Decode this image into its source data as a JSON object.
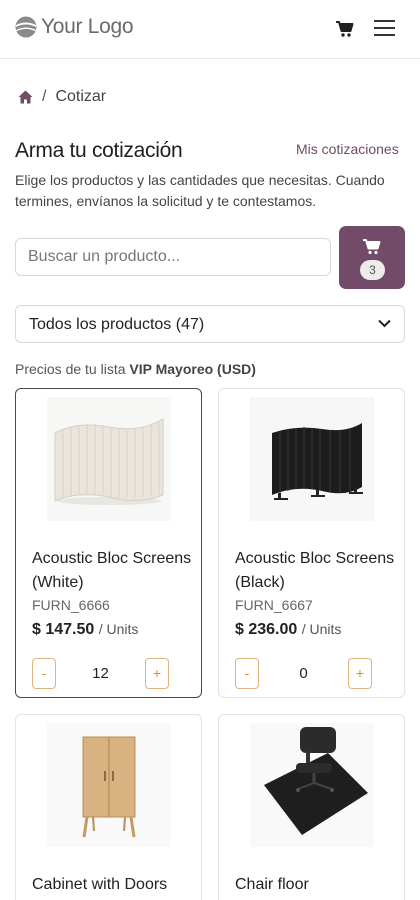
{
  "header": {
    "logo_text": "Your Logo",
    "icons": {
      "cart": "cart-icon",
      "menu": "hamburger-menu-icon"
    }
  },
  "breadcrumb": {
    "home_icon": "home-icon",
    "separator": "/",
    "current": "Cotizar"
  },
  "page": {
    "title": "Arma tu cotización",
    "my_quotes_link": "Mis cotizaciones",
    "description": "Elige los productos y las cantidades que necesitas. Cuando termines, envíanos la solicitud y te contestamos."
  },
  "search": {
    "placeholder": "Buscar un producto...",
    "value": ""
  },
  "cart": {
    "count": "3",
    "color": "#714b67"
  },
  "category_filter": {
    "selected": "Todos los productos (47)"
  },
  "pricelist": {
    "prefix": "Precios de tu lista",
    "name": "VIP Mayoreo (USD)"
  },
  "products": [
    {
      "name": "Acoustic Bloc Screens (White)",
      "code": "FURN_6666",
      "price": "$ 147.50",
      "unit": "/ Units",
      "qty": "12",
      "image": "white-acoustic-screen-image"
    },
    {
      "name": "Acoustic Bloc Screens (Black)",
      "code": "FURN_6667",
      "price": "$ 236.00",
      "unit": "/ Units",
      "qty": "0",
      "image": "black-acoustic-screen-image"
    },
    {
      "name": "Cabinet with Doors",
      "image": "wooden-cabinet-image"
    },
    {
      "name": "Chair floor",
      "image": "chair-floor-mat-image"
    }
  ],
  "qty_controls": {
    "minus": "-",
    "plus": "+"
  },
  "colors": {
    "brand": "#714b67",
    "accent_orange": "#d08f3a"
  }
}
